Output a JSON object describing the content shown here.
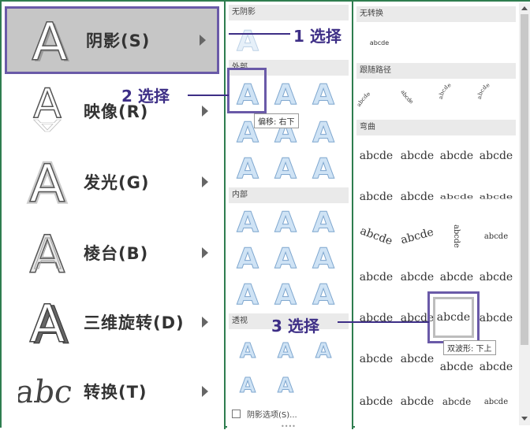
{
  "menu": {
    "items": [
      {
        "label": "阴影(S)",
        "icon": "shadow-A-icon"
      },
      {
        "label": "映像(R)",
        "icon": "reflection-A-icon"
      },
      {
        "label": "发光(G)",
        "icon": "glow-A-icon"
      },
      {
        "label": "棱台(B)",
        "icon": "bevel-A-icon"
      },
      {
        "label": "三维旋转(D)",
        "icon": "rotation-3d-A-icon"
      },
      {
        "label": "转换(T)",
        "icon": "transform-abc-icon"
      }
    ],
    "transform_sample": "abc"
  },
  "shadow_panel": {
    "sections": {
      "none": "无阴影",
      "outer": "外部",
      "inner": "内部",
      "perspective": "透视"
    },
    "glyph": "A",
    "tooltip": "偏移: 右下",
    "options_label": "阴影选项(S)..."
  },
  "transform_panel": {
    "sections": {
      "none": "无转换",
      "follow_path": "跟随路径",
      "warp": "弯曲"
    },
    "sample": "abcde",
    "tooltip": "双波形: 下上"
  },
  "annotations": {
    "step1": "1 选择",
    "step2": "2 选择",
    "step3": "3 选择"
  },
  "colors": {
    "accent": "#3d2e86",
    "selection": "#6a5aa8",
    "panel_border": "#2e7d4f",
    "glyph_fill": "#cfe3f5"
  }
}
